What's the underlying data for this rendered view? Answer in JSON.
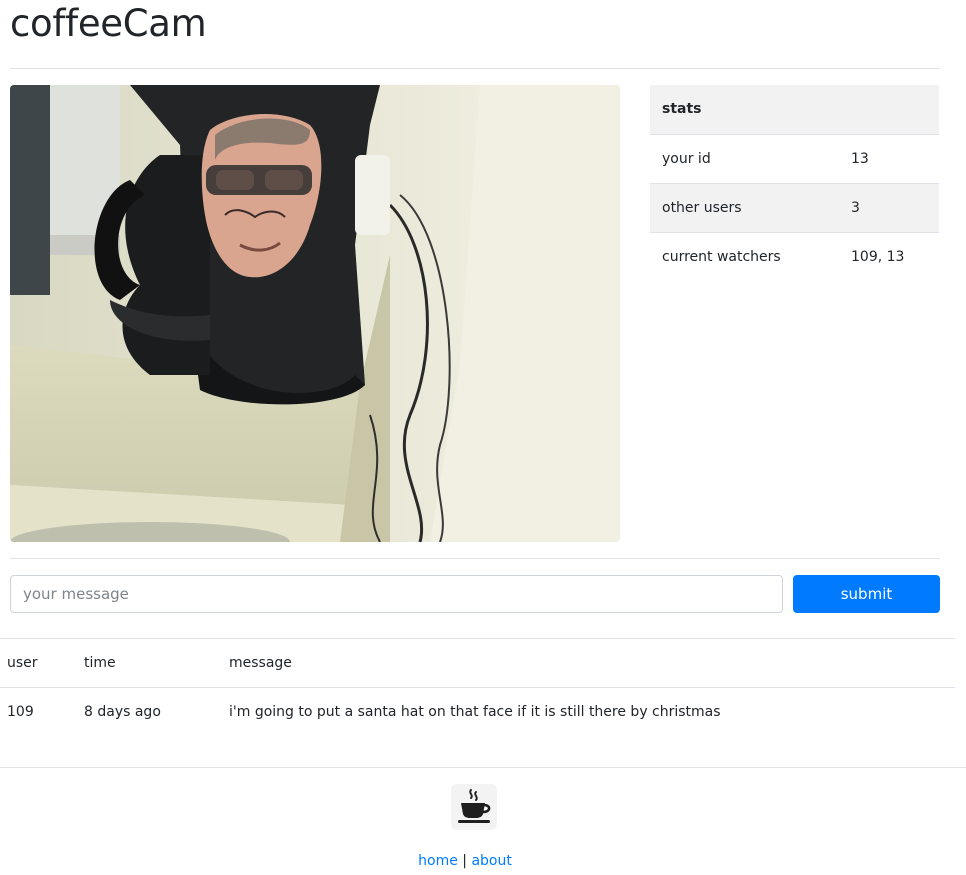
{
  "header": {
    "title": "coffeeCam"
  },
  "webcam": {
    "alt": "webcam feed of coffee maker",
    "description_icon": "webcam-image"
  },
  "stats": {
    "heading": "stats",
    "rows": [
      {
        "label": "your id",
        "value": "13"
      },
      {
        "label": "other users",
        "value": "3"
      },
      {
        "label": "current watchers",
        "value": "109, 13"
      }
    ]
  },
  "compose": {
    "placeholder": "your message",
    "submit_label": "submit"
  },
  "messages": {
    "columns": [
      "user",
      "time",
      "message"
    ],
    "rows": [
      {
        "user": "109",
        "time": "8 days ago",
        "message": "i'm going to put a santa hat on that face if it is still there by christmas"
      }
    ]
  },
  "footer": {
    "logo_icon": "coffee-cup-icon",
    "home_label": "home",
    "separator": "|",
    "about_label": "about"
  },
  "colors": {
    "accent": "#007bff",
    "stripe": "#f2f2f2",
    "border": "#dee2e6"
  }
}
